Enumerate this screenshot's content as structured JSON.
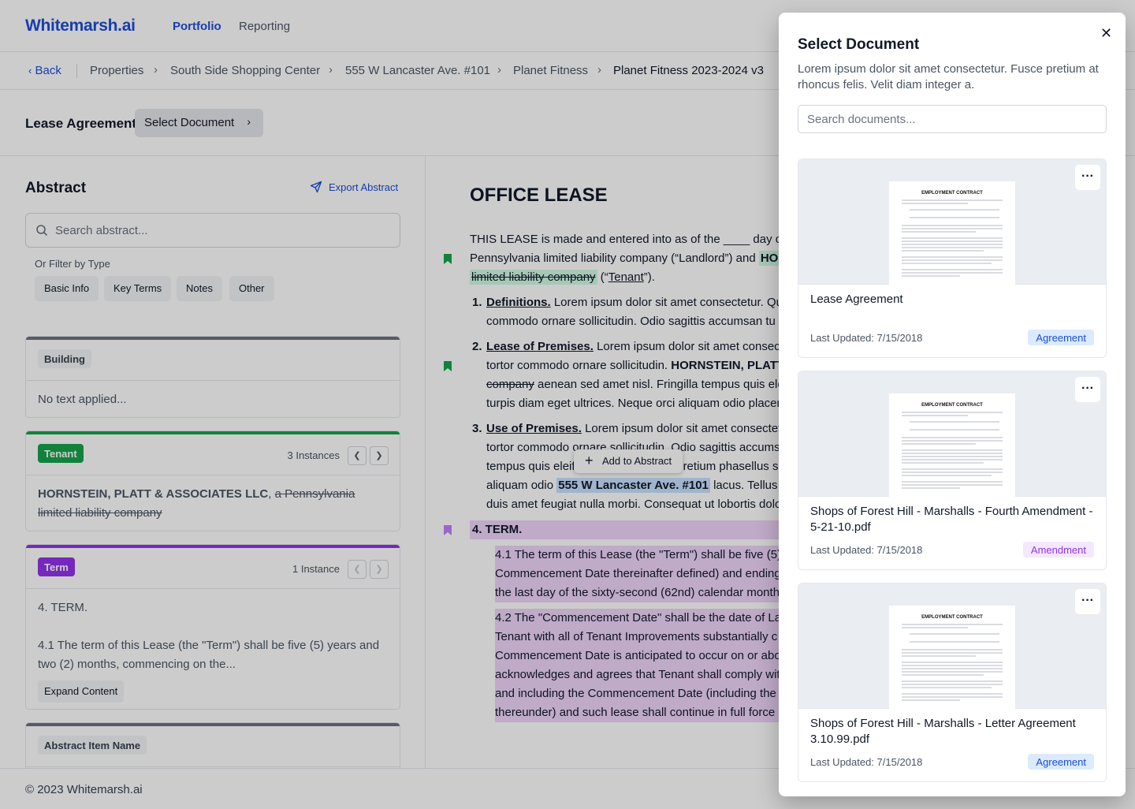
{
  "app": {
    "logo": "Whitemarsh.ai"
  },
  "nav": {
    "portfolio": "Portfolio",
    "reporting": "Reporting"
  },
  "breadcrumbs": {
    "back": "Back",
    "items": [
      "Properties",
      "South Side Shopping Center",
      "555 W Lancaster Ave. #101",
      "Planet Fitness",
      "Planet Fitness 2023-2024 v3"
    ]
  },
  "doc_header": {
    "title": "Lease Agreement",
    "select_button": "Select Document"
  },
  "abstract": {
    "title": "Abstract",
    "export": "Export Abstract",
    "search_placeholder": "Search abstract...",
    "filter_label": "Or Filter by Type",
    "filters": [
      "Basic Info",
      "Key Terms",
      "Notes",
      "Other"
    ],
    "cards": [
      {
        "tag": "Building",
        "body": "No text applied..."
      },
      {
        "tag": "Tenant",
        "instances": "3 Instances",
        "body_bold": "HORNSTEIN, PLATT & ASSOCIATES LLC",
        "body_sep": ", ",
        "body_strike": "a Pennsylvania limited liability company"
      },
      {
        "tag": "Term",
        "instances": "1 Instance",
        "line1": "4. TERM.",
        "line2": "4.1 The term of this Lease (the \"Term\") shall be five (5) years and two (2) months, commencing on the...",
        "expand": "Expand Content"
      },
      {
        "tag": "Abstract Item Name"
      }
    ]
  },
  "document": {
    "heading": "OFFICE LEASE",
    "p_a": "THIS LEASE is made and entered into as of the ____ day of D",
    "p_b_pre": "Pennsylvania limited liability company (“Landlord”) and ",
    "p_b_hl": "HO",
    "p_c_hl": "limited liability company",
    "p_c_post1": " (“",
    "p_c_tenant": "Tenant",
    "p_c_post2": "”).",
    "s1_num": "1.",
    "s1_head": "Definitions.",
    "s1_a": " Lorem ipsum dolor sit amet consectetur. Qu",
    "s1_b": "commodo ornare sollicitudin. Odio sagittis accumsan tu",
    "s2_num": "2.",
    "s2_head": "Lease of Premises.",
    "s2_a": " Lorem ipsum dolor sit amet consecte",
    "s2_b_pre": "tortor commodo ornare sollicitudin. ",
    "s2_b_bold": "HORNSTEIN, PLATT",
    "s2_c_strike": "company",
    "s2_c_post": " aenean sed amet nisl. Fringilla tempus quis ele",
    "s2_d": "turpis diam eget ultrices. Neque orci aliquam odio placer",
    "s3_num": "3.",
    "s3_head": "Use of Premises.",
    "s3_a": " Lorem ipsum dolor sit amet consectetu",
    "s3_b": "tortor commodo ornare sollicitudin. Odio sagittis accums",
    "s3_c_pre": "tempus quis eleif",
    "s3_c_post": "retium phasellus sa",
    "s3_d_pre": "aliquam odio ",
    "s3_d_hl": "555 W Lancaster Ave. #101",
    "s3_d_post": " lacus. Tellus rh",
    "s3_e": "duis amet feugiat nulla morbi. Consequat ut lobortis dolo",
    "s4_head": "4. TERM.",
    "s41_a": "4.1 The term of this Lease (the \"Term\") shall be five (5)",
    "s41_b": "Commencement Date thereinafter defined) and ending",
    "s41_c": "the last day of the sixty-second (62nd) calendar month",
    "s42_a": "4.2 The \"Commencement Date\" shall be the date of La",
    "s42_b": "Tenant with all of Tenant Improvements substantially c",
    "s42_c": "Commencement Date is anticipated to occur on or abo",
    "s42_d": "acknowledges and agrees that Tenant shall comply wit",
    "s42_e": "and including the Commencement Date (including the",
    "s42_f": "thereunder) and such lease shall continue in full force a",
    "add_to_abstract": "Add to Abstract"
  },
  "footer": {
    "copyright": "© 2023 Whitemarsh.ai"
  },
  "modal": {
    "title": "Select Document",
    "description": "Lorem ipsum dolor sit amet consectetur. Fusce pretium at rhoncus felis. Velit diam integer a.",
    "search_placeholder": "Search documents...",
    "thumb_heading": "EMPLOYMENT CONTRACT",
    "documents": [
      {
        "title": "Lease Agreement",
        "updated": "Last Updated: 7/15/2018",
        "type": "Agreement"
      },
      {
        "title": "Shops of Forest Hill - Marshalls - Fourth Amendment - 5-21-10.pdf",
        "updated": "Last Updated: 7/15/2018",
        "type": "Amendment"
      },
      {
        "title": "Shops of Forest Hill - Marshalls - Letter Agreement 3.10.99.pdf",
        "updated": "Last Updated: 7/15/2018",
        "type": "Agreement"
      }
    ]
  },
  "colors": {
    "brand": "#1d4ed8",
    "tenant_tag": "#16a34a",
    "term_tag": "#9333ea",
    "highlight_green": "#d1fae5",
    "highlight_blue": "#c9e2ff",
    "highlight_purple": "#efd5fb"
  }
}
